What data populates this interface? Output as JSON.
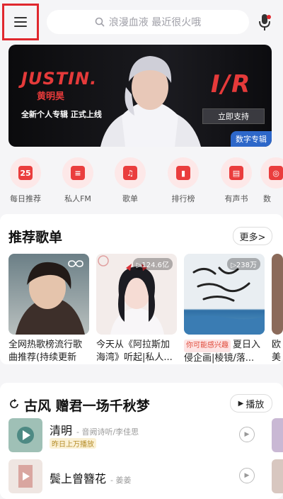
{
  "search": {
    "placeholder": "浪漫血液 最近很火哦"
  },
  "banner": {
    "brand_en": "JUSTIN.",
    "brand_cn": "黄明昊",
    "slogan": "全新个人专辑 正式上线",
    "album_logo": "I/R",
    "cta": "立即支持",
    "tag": "数字专辑"
  },
  "quick_entries": [
    {
      "label": "每日推荐",
      "icon": "calendar-icon",
      "glyph": "25"
    },
    {
      "label": "私人FM",
      "icon": "radio-icon",
      "glyph": "≡"
    },
    {
      "label": "歌单",
      "icon": "playlist-icon",
      "glyph": "♫"
    },
    {
      "label": "排行榜",
      "icon": "chart-icon",
      "glyph": "▮"
    },
    {
      "label": "有声书",
      "icon": "book-icon",
      "glyph": "▤"
    },
    {
      "label": "数",
      "icon": "digital-album-icon",
      "glyph": "◎"
    }
  ],
  "recommend": {
    "title": "推荐歌单",
    "more": "更多>",
    "playlists": [
      {
        "name": "全网热歌榜流行歌曲推荐(持续更新中)",
        "count": "",
        "hint": ""
      },
      {
        "name": "今天从《阿拉斯加海湾》听起|私人...",
        "count": "▷124.6亿",
        "hint": ""
      },
      {
        "name": "夏日入侵企画|棱镜/落...",
        "count": "▷238万",
        "hint": "你可能感兴趣"
      },
      {
        "name": "欧美奏",
        "count": "",
        "hint": ""
      }
    ]
  },
  "style_section": {
    "title": "古风 赠君一场千秋梦",
    "play": "播放",
    "songs": [
      {
        "title": "清明",
        "artist": "- 音阙诗听/李佳思",
        "badge": "昨日上万播放"
      },
      {
        "title": "鬓上曾簪花",
        "artist": "- 姜姜",
        "badge": ""
      }
    ]
  },
  "colors": {
    "accent": "#e0282e",
    "banner_tag": "#2d67c9"
  }
}
